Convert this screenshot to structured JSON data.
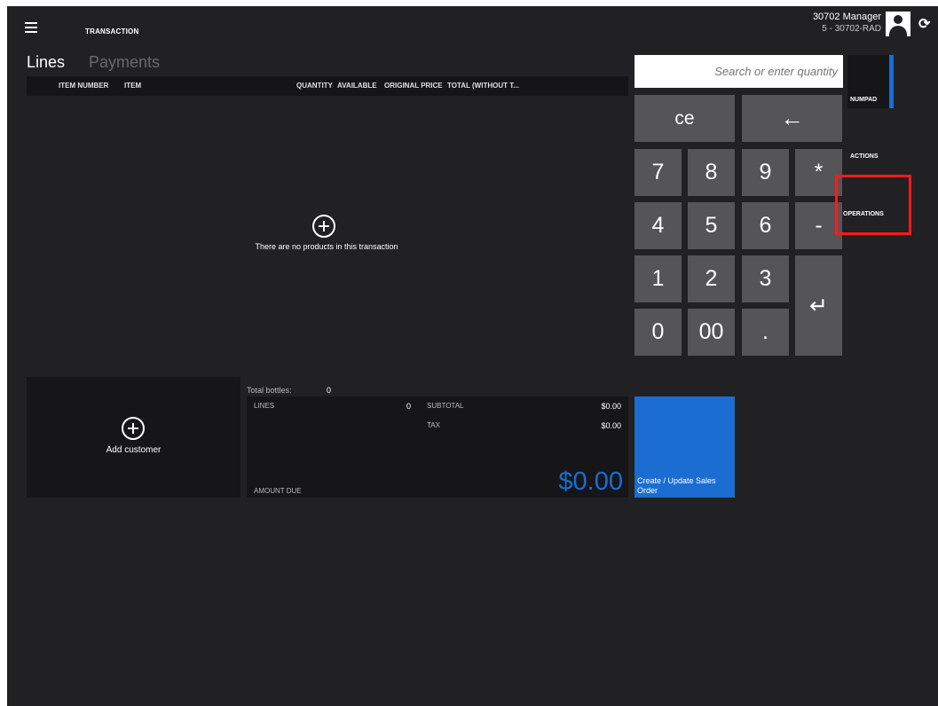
{
  "header": {
    "title": "TRANSACTION",
    "user_name": "30702 Manager",
    "store_id": "5 - 30702-RAD",
    "icons": [
      "hamburger-icon",
      "avatar-icon",
      "refresh-icon"
    ]
  },
  "tabs": [
    {
      "label": "Lines",
      "active": true
    },
    {
      "label": "Payments",
      "active": false
    }
  ],
  "grid": {
    "columns": [
      "ITEM NUMBER",
      "ITEM",
      "QUANTITY",
      "AVAILABLE",
      "ORIGINAL PRICE",
      "TOTAL (WITHOUT T..."
    ],
    "empty_message": "There are no products in this transaction"
  },
  "customer": {
    "add_label": "Add customer"
  },
  "totals": {
    "bottles_label": "Total bottles:",
    "bottles_value": "0",
    "lines_label": "LINES",
    "lines_value": "0",
    "subtotal_label": "SUBTOTAL",
    "subtotal_value": "$0.00",
    "tax_label": "TAX",
    "tax_value": "$0.00",
    "amount_due_label": "AMOUNT DUE",
    "amount_due_value": "$0.00"
  },
  "sales_order": {
    "label": "Create / Update Sales Order"
  },
  "numpad": {
    "search_placeholder": "Search or enter quantity",
    "ce": "ce",
    "backspace": "←",
    "keys": {
      "k7": "7",
      "k8": "8",
      "k9": "9",
      "star": "*",
      "k4": "4",
      "k5": "5",
      "k6": "6",
      "minus": "-",
      "k1": "1",
      "k2": "2",
      "k3": "3",
      "enter": "↵",
      "k0": "0",
      "k00": "00",
      "dot": "."
    }
  },
  "side_nav": {
    "numpad": "NUMPAD",
    "actions": "ACTIONS",
    "operations": "OPERATIONS"
  },
  "colors": {
    "background": "#212124",
    "panel": "#161618",
    "key": "#555558",
    "accent": "#1b6dd1",
    "highlight": "#ff1a1a"
  }
}
